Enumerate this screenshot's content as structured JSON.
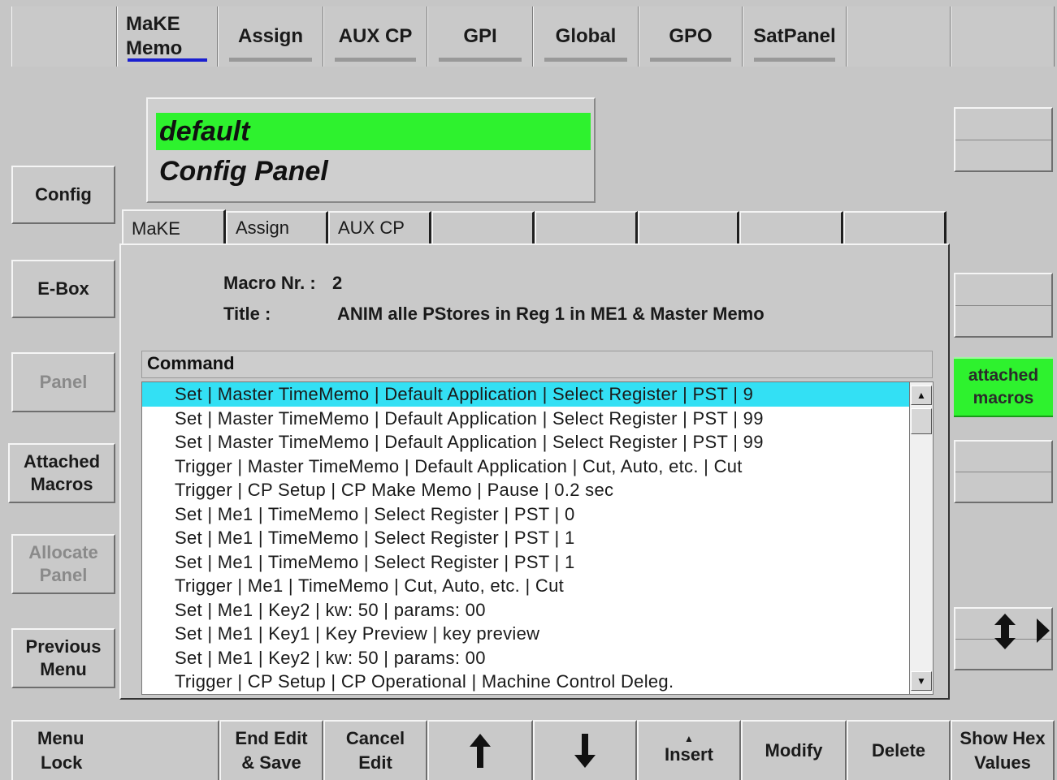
{
  "top_tabs": [
    {
      "line1": "MaKE",
      "line2": "Memo",
      "active": true
    },
    {
      "label": "Assign"
    },
    {
      "label": "AUX CP"
    },
    {
      "label": "GPI"
    },
    {
      "label": "Global"
    },
    {
      "label": "GPO"
    },
    {
      "label": "SatPanel"
    }
  ],
  "header": {
    "name": "default",
    "subtitle": "Config Panel"
  },
  "left_menu": {
    "config": "Config",
    "ebox": "E-Box",
    "panel": "Panel",
    "attached_l1": "Attached",
    "attached_l2": "Macros",
    "allocate_l1": "Allocate",
    "allocate_l2": "Panel",
    "previous_l1": "Previous",
    "previous_l2": "Menu"
  },
  "inner_tabs": [
    "MaKE",
    "Assign",
    "AUX CP"
  ],
  "macro": {
    "number_label": "Macro Nr. :",
    "number_value": "2",
    "title_label": "Title :",
    "title_value": "ANIM alle PStores in Reg 1 in ME1 & Master Memo"
  },
  "command_header": "Command",
  "commands": [
    "Set | Master TimeMemo | Default Application | Select Register | PST | 9",
    "Set | Master TimeMemo | Default Application | Select Register | PST | 99",
    "Set | Master TimeMemo | Default Application | Select Register | PST | 99",
    "Trigger | Master TimeMemo | Default Application | Cut, Auto, etc. | Cut",
    "Trigger | CP Setup | CP Make Memo | Pause | 0.2 sec",
    "Set | Me1 | TimeMemo | Select Register | PST | 0",
    "Set | Me1 | TimeMemo | Select Register | PST | 1",
    "Set | Me1 | TimeMemo | Select Register | PST | 1",
    "Trigger | Me1 | TimeMemo | Cut, Auto, etc. | Cut",
    "Set | Me1 | Key2 | kw: 50  | params: 00",
    "Set | Me1 | Key1 | Key Preview | key preview",
    "Set | Me1 | Key2 | kw: 50  | params: 00",
    "Trigger | CP Setup | CP Operational | Machine Control Deleg."
  ],
  "right": {
    "attached_l1": "attached",
    "attached_l2": "macros"
  },
  "bottom": {
    "menu_lock_l1": "Menu",
    "menu_lock_l2": "Lock",
    "end_edit_l1": "End Edit",
    "end_edit_l2": "& Save",
    "cancel_l1": "Cancel",
    "cancel_l2": "Edit",
    "insert": "Insert",
    "modify": "Modify",
    "delete": "Delete",
    "show_hex_l1": "Show Hex",
    "show_hex_l2": "Values"
  }
}
